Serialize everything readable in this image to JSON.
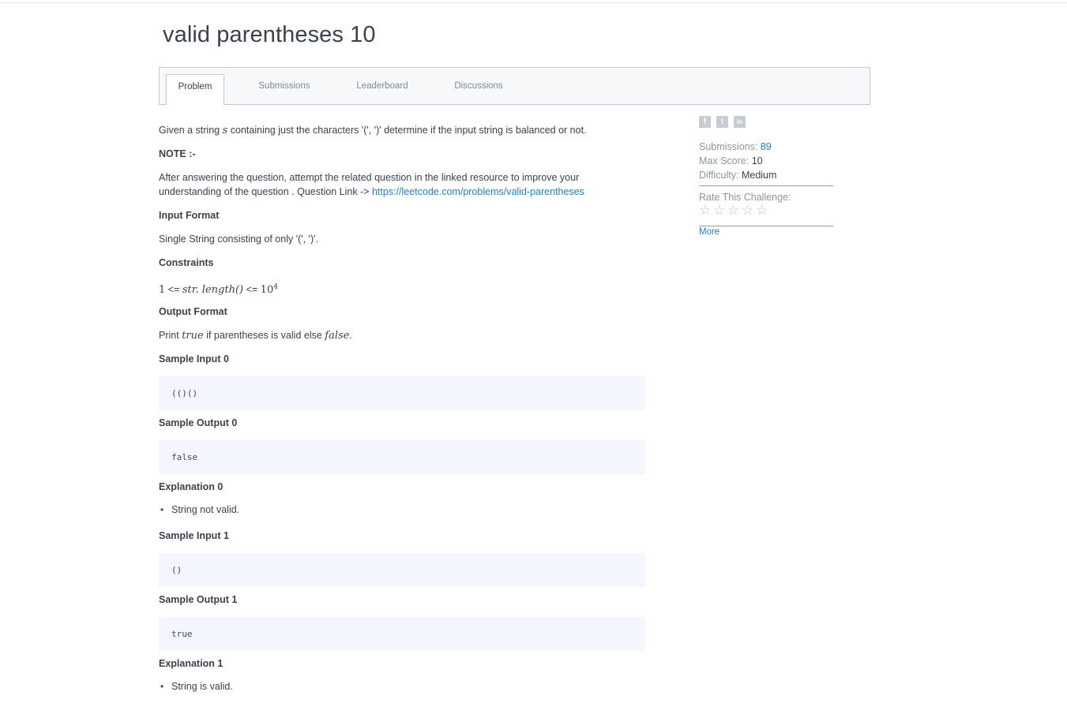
{
  "title": "valid parentheses 10",
  "tabs": [
    {
      "label": "Problem",
      "active": true
    },
    {
      "label": "Submissions",
      "active": false
    },
    {
      "label": "Leaderboard",
      "active": false
    },
    {
      "label": "Discussions",
      "active": false
    }
  ],
  "problem": {
    "intro_pre": "Given a string",
    "intro_var": "s",
    "intro_post": "containing just the characters '(', ')' determine if the input string is balanced or not.",
    "note_heading": "NOTE :-",
    "note_text_line1": "After answering the question, attempt the related question in the linked resource to improve your",
    "note_text_line2": "understanding of the question . Question Link ->",
    "note_link": "https://leetcode.com/problems/valid-parentheses",
    "input_format_heading": "Input Format",
    "input_format_text": "Single String consisting of only '(', ')'.",
    "constraints_heading": "Constraints",
    "constraints": {
      "lower": "1",
      "op1": "<=",
      "expr": "str. length()",
      "op2": "<=",
      "base": "10",
      "exponent": "4"
    },
    "output_format_heading": "Output Format",
    "output_format": {
      "pre": "Print",
      "true_word": "true",
      "mid": "if parentheses is valid else",
      "false_word": "false",
      "end": "."
    },
    "samples": [
      {
        "input_heading": "Sample Input 0",
        "input": "(()()",
        "output_heading": "Sample Output 0",
        "output": "false",
        "explanation_heading": "Explanation 0",
        "explanation": "String not valid."
      },
      {
        "input_heading": "Sample Input 1",
        "input": "()",
        "output_heading": "Sample Output 1",
        "output": "true",
        "explanation_heading": "Explanation 1",
        "explanation": "String is valid."
      }
    ]
  },
  "sidebar": {
    "share_icons": [
      {
        "name": "facebook-icon",
        "glyph": "f"
      },
      {
        "name": "twitter-icon",
        "glyph": "t"
      },
      {
        "name": "linkedin-icon",
        "glyph": "in"
      }
    ],
    "submissions_label": "Submissions:",
    "submissions_value": "89",
    "max_score_label": "Max Score:",
    "max_score_value": "10",
    "difficulty_label": "Difficulty:",
    "difficulty_value": "Medium",
    "rate_label": "Rate This Challenge:",
    "stars": [
      "☆",
      "☆",
      "☆",
      "☆",
      "☆"
    ],
    "rating": 0,
    "more_label": "More"
  },
  "colors": {
    "link": "#1f80d3",
    "text": "#39424e",
    "code_bg": "#f3f7fd"
  }
}
